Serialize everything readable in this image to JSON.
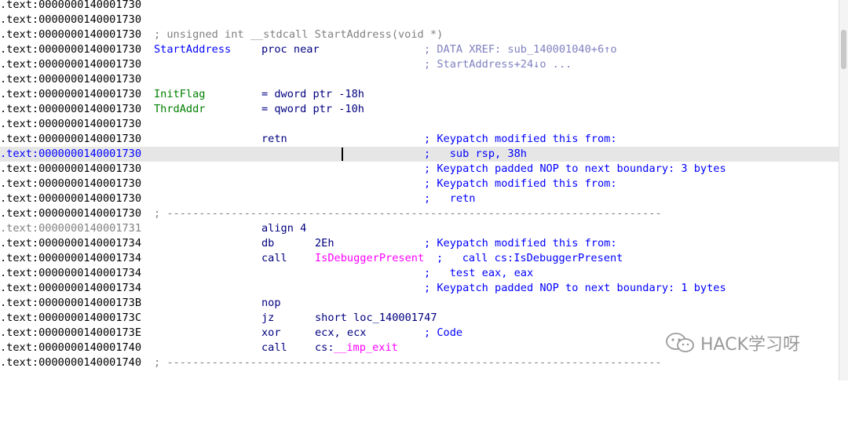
{
  "lines": [
    {
      "addr": ".text:0000000140001730"
    },
    {
      "addr": ".text:0000000140001730"
    },
    {
      "addr": ".text:0000000140001730",
      "header": "; unsigned int __stdcall StartAddress(void *)"
    },
    {
      "addr": ".text:0000000140001730",
      "label": "StartAddress",
      "mnem": "proc near",
      "comment": "; DATA XREF: sub_140001040+6↑o"
    },
    {
      "addr": ".text:0000000140001730",
      "comment": "; StartAddress+24↓o ..."
    },
    {
      "addr": ".text:0000000140001730"
    },
    {
      "addr": ".text:0000000140001730",
      "label": "InitFlag",
      "mnem": "= dword ptr -18h"
    },
    {
      "addr": ".text:0000000140001730",
      "label": "ThrdAddr",
      "mnem": "= qword ptr -10h"
    },
    {
      "addr": ".text:0000000140001730"
    },
    {
      "addr": ".text:0000000140001730",
      "mnem": "retn",
      "comment": "; Keypatch modified this from:"
    },
    {
      "addr": ".text:0000000140001730",
      "comment": ";   sub rsp, 38h"
    },
    {
      "addr": ".text:0000000140001730",
      "comment": "; Keypatch padded NOP to next boundary: 3 bytes"
    },
    {
      "addr": ".text:0000000140001730",
      "comment": "; Keypatch modified this from:"
    },
    {
      "addr": ".text:0000000140001730",
      "comment": ";   retn"
    },
    {
      "addr": ".text:0000000140001730",
      "separator": "; -----------------------------------------------------------------------------"
    },
    {
      "addr": ".text:0000000140001731",
      "mnem": "align 4"
    },
    {
      "addr": ".text:0000000140001734",
      "mnem": "db",
      "operand": "2Eh",
      "comment": "; Keypatch modified this from:"
    },
    {
      "addr": ".text:0000000140001734",
      "mnem": "call",
      "operand": "IsDebuggerPresent",
      "comment": ";   call cs:IsDebuggerPresent"
    },
    {
      "addr": ".text:0000000140001734",
      "comment": ";   test eax, eax"
    },
    {
      "addr": ".text:0000000140001734",
      "comment": "; Keypatch padded NOP to next boundary: 1 bytes"
    },
    {
      "addr": ".text:000000014000173B",
      "mnem": "nop"
    },
    {
      "addr": ".text:000000014000173C",
      "mnem": "jz",
      "operand": "short loc_140001747"
    },
    {
      "addr": ".text:000000014000173E",
      "mnem": "xor",
      "operand": "ecx, ecx",
      "comment": "; Code"
    },
    {
      "addr": ".text:0000000140001740",
      "mnem": "call",
      "operand_prefix": "cs:",
      "operand": "__imp_exit"
    },
    {
      "addr": ".text:0000000140001740",
      "separator": "; -----------------------------------------------------------------------------"
    }
  ],
  "watermark": {
    "text": "HACK学习呀",
    "icon": "wechat-icon"
  },
  "colors": {
    "address": "#000000",
    "label_blue": "#0000ff",
    "label_green": "#008000",
    "mnemonic": "#000080",
    "comment": "#0000ff",
    "xref_comment": "#8080c0",
    "import_name": "#ff00ff",
    "highlight_row": "#e6e6e6"
  }
}
